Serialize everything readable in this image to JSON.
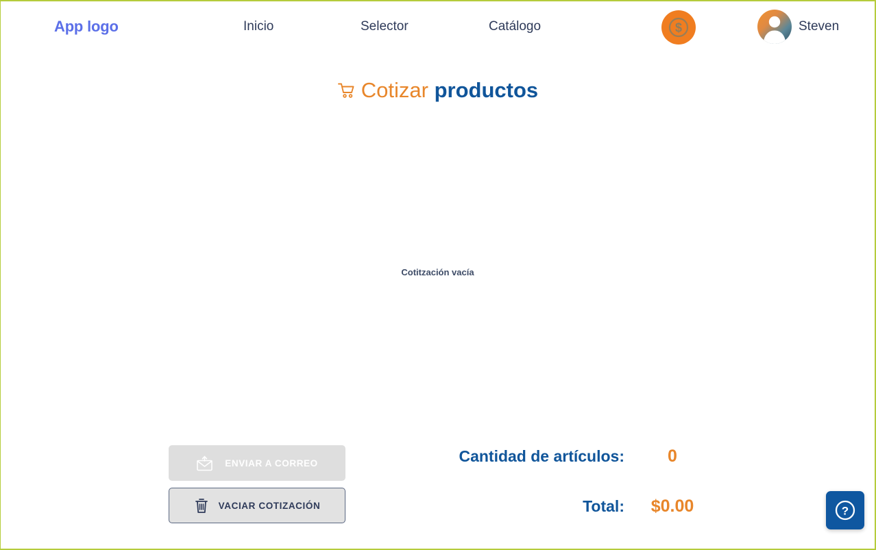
{
  "navbar": {
    "logo": "App logo",
    "links": [
      {
        "label": "Inicio",
        "name": "nav-link-inicio"
      },
      {
        "label": "Selector",
        "name": "nav-link-selector"
      },
      {
        "label": "Catálogo",
        "name": "nav-link-catalogo"
      }
    ],
    "coin_icon": "coin-dollar-icon",
    "avatar_icon": "user-avatar-icon",
    "user_name": "Steven"
  },
  "page": {
    "cart_icon": "shopping-cart-icon",
    "title_accent": "Cotizar",
    "title_strong": "productos"
  },
  "main": {
    "empty_message": "Cotitzación vacía"
  },
  "actions": {
    "send_icon": "envelope-send-icon",
    "send_label": "ENVIAR A CORREO",
    "send_disabled": true,
    "clear_icon": "trash-icon",
    "clear_label": "VACIAR COTIZACIÓN"
  },
  "totals": {
    "rows": [
      {
        "label": "Cantidad de artículos:",
        "value": "0"
      },
      {
        "label": "Total:",
        "value": "$0.00"
      }
    ]
  },
  "help": {
    "icon": "question-circle-icon"
  },
  "colors": {
    "frame_border": "#b5cc3c",
    "logo_blue": "#5b6fe8",
    "nav_text": "#2e3a59",
    "accent_orange": "#e8862a",
    "brand_blue": "#10559a",
    "help_blue": "#0f57a0",
    "coin_orange": "#f07d20"
  }
}
